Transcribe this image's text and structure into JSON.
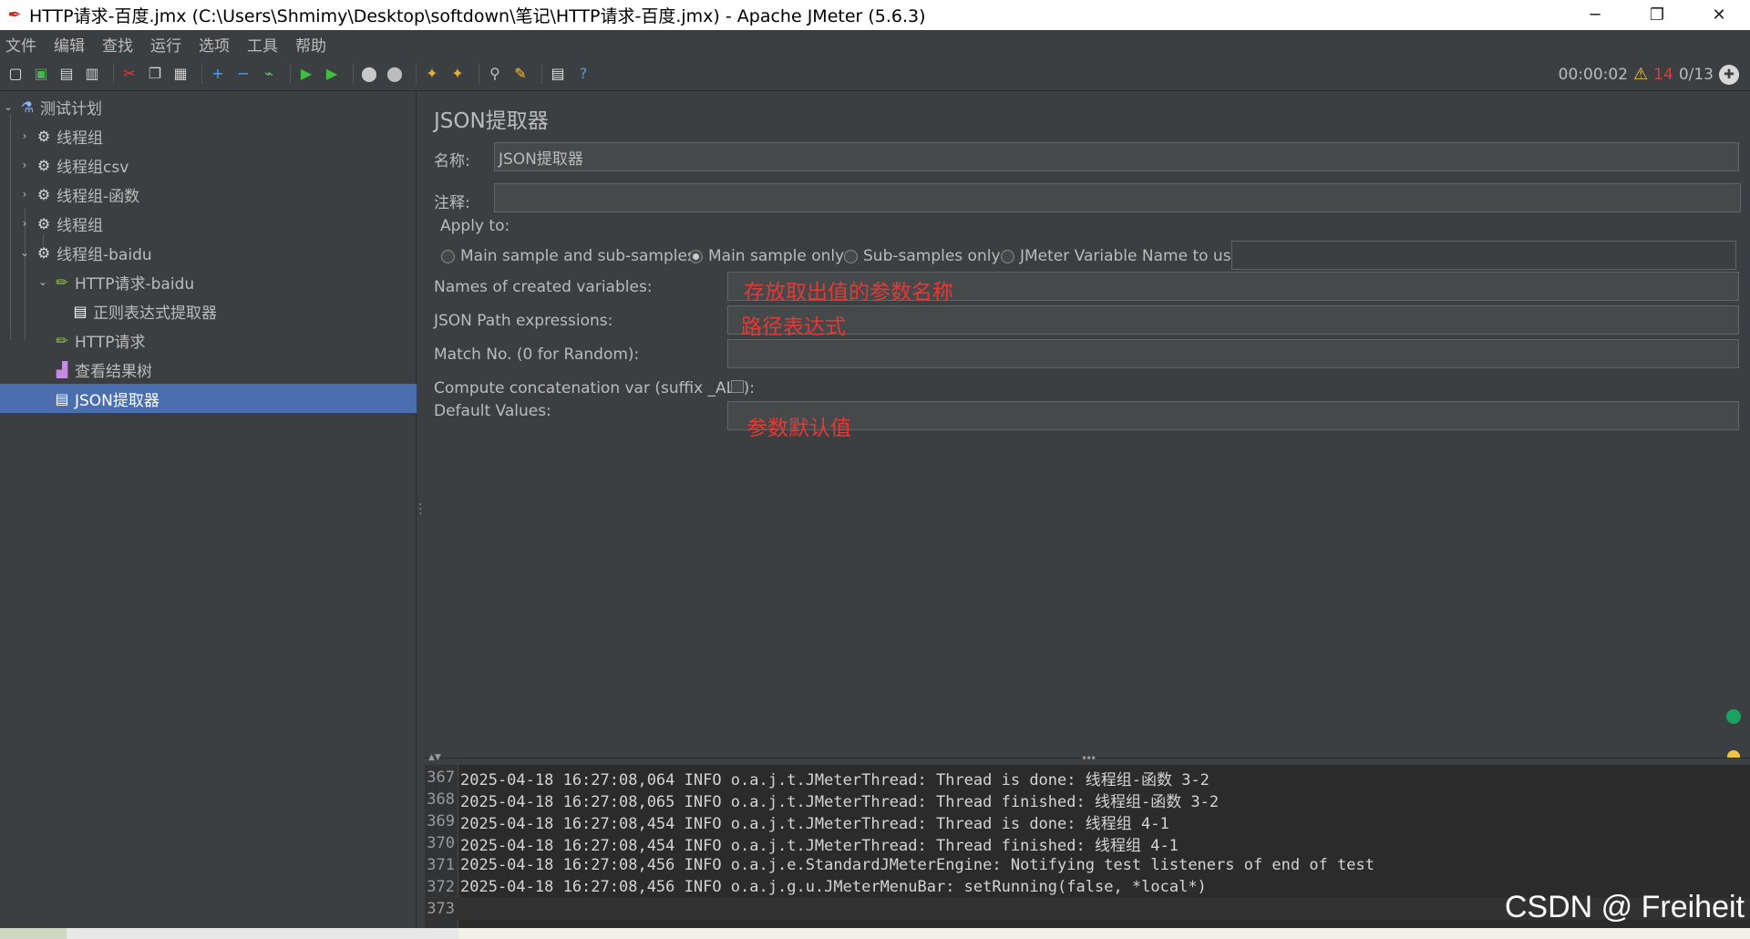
{
  "window": {
    "title": "HTTP请求-百度.jmx (C:\\Users\\Shmimy\\Desktop\\softdown\\笔记\\HTTP请求-百度.jmx) - Apache JMeter (5.6.3)",
    "minimize": "─",
    "restore": "❐",
    "close": "✕"
  },
  "menu": [
    "文件",
    "编辑",
    "查找",
    "运行",
    "选项",
    "工具",
    "帮助"
  ],
  "toolbar": {
    "elapsed": "00:00:02",
    "warning_count": "14",
    "threads": "0/13",
    "icons": [
      {
        "name": "new-icon",
        "glyph": "▢",
        "color": "#e0e0e0"
      },
      {
        "name": "templates-icon",
        "glyph": "▣",
        "color": "#4caf50"
      },
      {
        "name": "open-icon",
        "glyph": "▤",
        "color": "#d0d0d0"
      },
      {
        "name": "save-icon",
        "glyph": "▥",
        "color": "#d0d0d0"
      },
      {
        "name": "cut-icon",
        "glyph": "✂",
        "color": "#e53935"
      },
      {
        "name": "copy-icon",
        "glyph": "❐",
        "color": "#d0d0d0"
      },
      {
        "name": "paste-icon",
        "glyph": "▦",
        "color": "#d0d0d0"
      },
      {
        "name": "expand-icon",
        "glyph": "+",
        "color": "#5c9ded"
      },
      {
        "name": "collapse-icon",
        "glyph": "−",
        "color": "#5c9ded"
      },
      {
        "name": "toggle-icon",
        "glyph": "⌁",
        "color": "#6fbf73"
      },
      {
        "name": "start-icon",
        "glyph": "▶",
        "color": "#3fbf3f"
      },
      {
        "name": "start-no-pause-icon",
        "glyph": "▶",
        "color": "#3fbf3f"
      },
      {
        "name": "stop-icon",
        "glyph": "⬤",
        "color": "#c8c8c8"
      },
      {
        "name": "shutdown-icon",
        "glyph": "⬤",
        "color": "#bdbdbd"
      },
      {
        "name": "clear-icon",
        "glyph": "✦",
        "color": "#e0b040"
      },
      {
        "name": "clear-all-icon",
        "glyph": "✦",
        "color": "#e0b040"
      },
      {
        "name": "search-icon",
        "glyph": "⚲",
        "color": "#c0c0c0"
      },
      {
        "name": "reset-search-icon",
        "glyph": "✎",
        "color": "#f5c542"
      },
      {
        "name": "function-helper-icon",
        "glyph": "▤",
        "color": "#e0e0e0"
      },
      {
        "name": "help-icon",
        "glyph": "?",
        "color": "#5c9ded"
      }
    ]
  },
  "tree": [
    {
      "label": "测试计划",
      "icon": "flask-icon",
      "glyph": "⚗",
      "color": "#8ab4f8",
      "caret": "⌄",
      "depth": 0
    },
    {
      "label": "线程组",
      "icon": "gear-icon",
      "glyph": "⚙",
      "color": "#d8d8d8",
      "caret": "›",
      "depth": 1
    },
    {
      "label": "线程组csv",
      "icon": "gear-icon",
      "glyph": "⚙",
      "color": "#d8d8d8",
      "caret": "›",
      "depth": 1
    },
    {
      "label": "线程组-函数",
      "icon": "gear-icon",
      "glyph": "⚙",
      "color": "#d8d8d8",
      "caret": "›",
      "depth": 1
    },
    {
      "label": "线程组",
      "icon": "gear-icon",
      "glyph": "⚙",
      "color": "#d8d8d8",
      "caret": "›",
      "depth": 1
    },
    {
      "label": "线程组-baidu",
      "icon": "gear-icon",
      "glyph": "⚙",
      "color": "#d8d8d8",
      "caret": "⌄",
      "depth": 1
    },
    {
      "label": "HTTP请求-baidu",
      "icon": "pencil-icon",
      "glyph": "✏",
      "color": "#8bc34a",
      "caret": "⌄",
      "depth": 2
    },
    {
      "label": "正则表达式提取器",
      "icon": "document-icon",
      "glyph": "▤",
      "color": "#ffffff",
      "caret": "",
      "depth": 3
    },
    {
      "label": "HTTP请求",
      "icon": "pencil-icon",
      "glyph": "✏",
      "color": "#8bc34a",
      "caret": "",
      "depth": 2
    },
    {
      "label": "查看结果树",
      "icon": "chart-icon",
      "glyph": "▟",
      "color": "#c48be0",
      "caret": "",
      "depth": 2
    },
    {
      "label": "JSON提取器",
      "icon": "document-icon",
      "glyph": "▤",
      "color": "#ffffff",
      "caret": "",
      "depth": 2,
      "selected": true
    }
  ],
  "form": {
    "title": "JSON提取器",
    "name_label": "名称:",
    "name_value": "JSON提取器",
    "comment_label": "注释:",
    "comment_value": "",
    "apply_to_label": "Apply to:",
    "radios": [
      {
        "label": "Main sample and sub-samples",
        "checked": false
      },
      {
        "label": "Main sample only",
        "checked": true
      },
      {
        "label": "Sub-samples only",
        "checked": false
      },
      {
        "label": "JMeter Variable Name to use",
        "checked": false
      }
    ],
    "variable_name_value": "",
    "names_label": "Names of created variables:",
    "names_value": "",
    "names_annotation": "存放取出值的参数名称",
    "path_label": "JSON Path expressions:",
    "path_value": "",
    "path_annotation": "路径表达式",
    "match_label": "Match No. (0 for Random):",
    "match_value": "",
    "concat_label": "Compute concatenation var (suffix _ALL):",
    "concat_checked": false,
    "default_label": "Default Values:",
    "default_value": "",
    "default_annotation": "参数默认值"
  },
  "log": [
    {
      "n": "367",
      "text": "2025-04-18 16:27:08,064 INFO o.a.j.t.JMeterThread: Thread is done: 线程组-函数 3-2"
    },
    {
      "n": "368",
      "text": "2025-04-18 16:27:08,065 INFO o.a.j.t.JMeterThread: Thread finished: 线程组-函数 3-2"
    },
    {
      "n": "369",
      "text": "2025-04-18 16:27:08,454 INFO o.a.j.t.JMeterThread: Thread is done: 线程组 4-1"
    },
    {
      "n": "370",
      "text": "2025-04-18 16:27:08,454 INFO o.a.j.t.JMeterThread: Thread finished: 线程组 4-1"
    },
    {
      "n": "371",
      "text": "2025-04-18 16:27:08,456 INFO o.a.j.e.StandardJMeterEngine: Notifying test listeners of end of test"
    },
    {
      "n": "372",
      "text": "2025-04-18 16:27:08,456 INFO o.a.j.g.u.JMeterMenuBar: setRunning(false, *local*)"
    },
    {
      "n": "373",
      "text": ""
    }
  ],
  "watermark": "CSDN @ Freiheit",
  "colors": {
    "background": "#3c3f41",
    "selection": "#4b6eaf",
    "annotation": "#e53935",
    "log_background": "#2b2b2b"
  }
}
